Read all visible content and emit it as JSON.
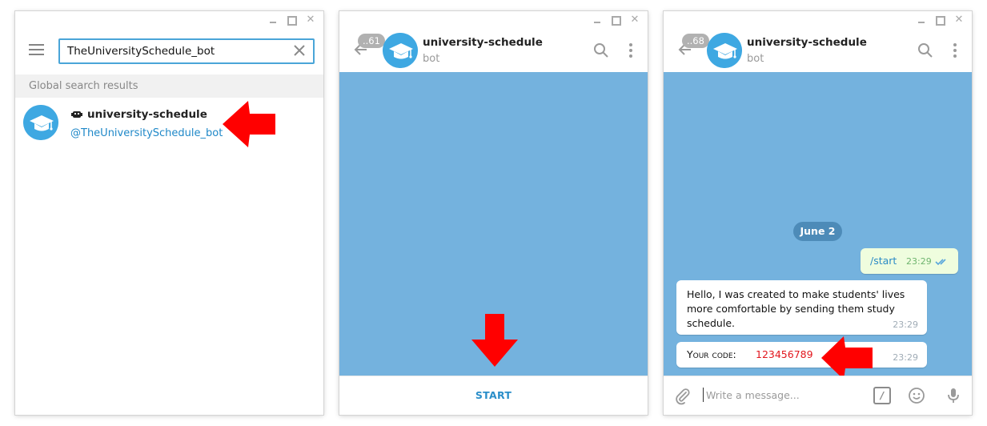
{
  "search_window": {
    "search": {
      "value": "TheUniversitySchedule_bot",
      "placeholder": ""
    },
    "section_header": "Global search results",
    "result": {
      "name": "university-schedule",
      "handle": "@TheUniversitySchedule_bot"
    }
  },
  "chat_before": {
    "header": {
      "title": "university-schedule",
      "subtitle": "bot",
      "unread": "..61"
    },
    "start_label": "START"
  },
  "chat_after": {
    "header": {
      "title": "university-schedule",
      "subtitle": "bot",
      "unread": "..68"
    },
    "date": "June 2",
    "messages": [
      {
        "direction": "out",
        "text": "/start",
        "time": "23:29"
      },
      {
        "direction": "in",
        "text": "Hello, I was created to make students' lives more comfortable by sending them study schedule.",
        "time": "23:29"
      },
      {
        "direction": "in",
        "label": "Your code:",
        "code": "123456789",
        "time": "23:29"
      }
    ],
    "compose": {
      "placeholder": "Write a message..."
    }
  },
  "icons": [
    "menu-icon",
    "clear-icon",
    "bot-icon",
    "back-arrow-icon",
    "search-icon",
    "more-icon",
    "attach-icon",
    "command-icon",
    "emoji-icon",
    "microphone-icon",
    "double-check-icon",
    "graduation-cap-icon"
  ],
  "colors": {
    "accent": "#4aa5d8",
    "chat_background": "#74b2de",
    "date_pill": "#4d8bb8",
    "outgoing_bubble": "#effdde",
    "annotation_arrow": "#ff0000",
    "code_text": "#e2161d"
  }
}
